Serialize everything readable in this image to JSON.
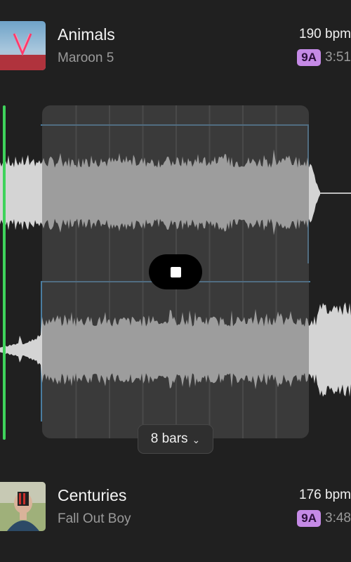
{
  "deck_top": {
    "title": "Animals",
    "artist": "Maroon 5",
    "bpm": "190 bpm",
    "key": "9A",
    "duration": "3:51"
  },
  "deck_bottom": {
    "title": "Centuries",
    "artist": "Fall Out Boy",
    "bpm": "176 bpm",
    "key": "9A",
    "duration": "3:48"
  },
  "transition": {
    "loop_length": "8 bars",
    "dropdown_icon": "chevron-down-icon",
    "stop_icon": "stop-icon"
  },
  "colors": {
    "playhead": "#3fd35b",
    "key_badge": "#c58ae6",
    "loop_marker": "#4a7da0"
  }
}
